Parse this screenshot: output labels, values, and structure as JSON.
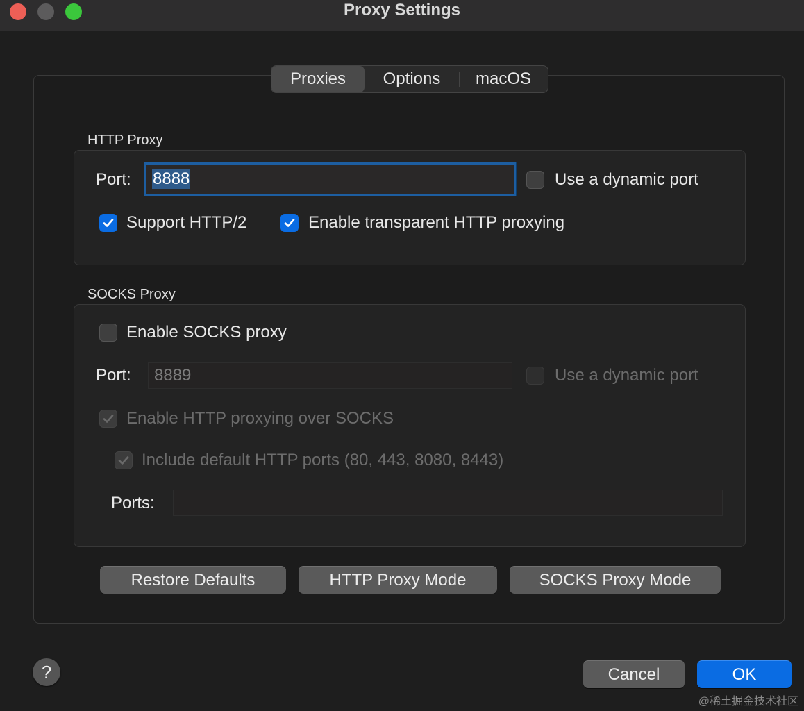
{
  "window": {
    "title": "Proxy Settings"
  },
  "tabs": [
    {
      "label": "Proxies",
      "selected": true
    },
    {
      "label": "Options"
    },
    {
      "label": "macOS"
    }
  ],
  "http_proxy": {
    "group_label": "HTTP Proxy",
    "port_label": "Port:",
    "port_value": "8888",
    "dynamic_port_label": "Use a dynamic port",
    "dynamic_port_checked": false,
    "support_http2_label": "Support HTTP/2",
    "support_http2_checked": true,
    "transparent_label": "Enable transparent HTTP proxying",
    "transparent_checked": true
  },
  "socks_proxy": {
    "group_label": "SOCKS Proxy",
    "enable_label": "Enable SOCKS proxy",
    "enable_checked": false,
    "port_label": "Port:",
    "port_value": "8889",
    "dynamic_port_label": "Use a dynamic port",
    "http_over_socks_label": "Enable HTTP proxying over SOCKS",
    "http_over_socks_checked": true,
    "include_default_label": "Include default HTTP ports (80, 443, 8080, 8443)",
    "include_default_checked": true,
    "ports_label": "Ports:",
    "ports_value": ""
  },
  "actions": {
    "restore_defaults": "Restore Defaults",
    "http_proxy_mode": "HTTP Proxy Mode",
    "socks_proxy_mode": "SOCKS Proxy Mode"
  },
  "footer": {
    "help": "?",
    "cancel": "Cancel",
    "ok": "OK"
  },
  "watermark": "@稀土掘金技术社区",
  "colors": {
    "accent": "#0a6ce3",
    "focus_ring": "#1d5ea1",
    "background": "#1e1e1e"
  }
}
